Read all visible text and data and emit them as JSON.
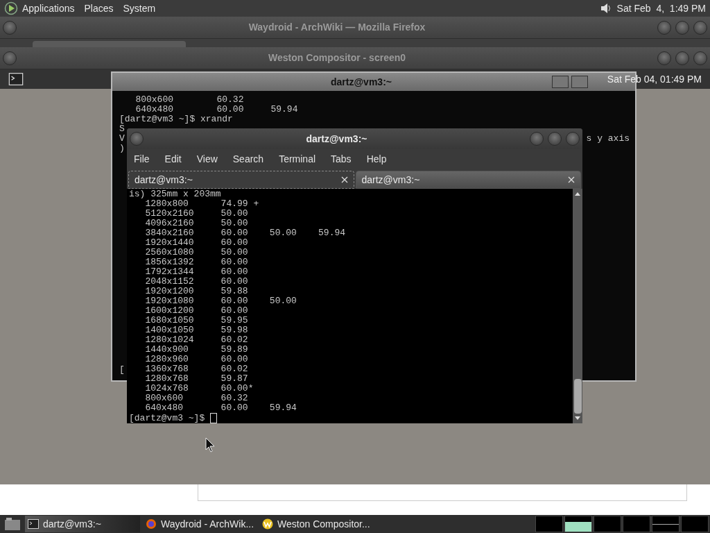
{
  "top_panel": {
    "menus": [
      "Applications",
      "Places",
      "System"
    ],
    "clock": "Sat Feb  4,  1:49 PM"
  },
  "firefox_window": {
    "title": "Waydroid - ArchWiki — Mozilla Firefox"
  },
  "weston_window": {
    "title": "Weston Compositor - screen0",
    "clock": "Sat Feb 04, 01:49 PM"
  },
  "back_terminal": {
    "title": "dartz@vm3:~",
    "lines": [
      "   800x600        60.32",
      "   640x480        60.00     59.94",
      "[dartz@vm3 ~]$ xrandr",
      "S",
      "V",
      ")"
    ],
    "right_fragment": "s y axis",
    "last_line": "["
  },
  "front_terminal": {
    "title": "dartz@vm3:~",
    "menu": [
      "File",
      "Edit",
      "View",
      "Search",
      "Terminal",
      "Tabs",
      "Help"
    ],
    "tabs": [
      {
        "label": "dartz@vm3:~",
        "selected": true
      },
      {
        "label": "dartz@vm3:~",
        "selected": false
      }
    ],
    "lines": [
      "is) 325mm x 203mm",
      "   1280x800      74.99 +",
      "   5120x2160     50.00",
      "   4096x2160     50.00",
      "   3840x2160     60.00    50.00    59.94",
      "   1920x1440     60.00",
      "   2560x1080     50.00",
      "   1856x1392     60.00",
      "   1792x1344     60.00",
      "   2048x1152     60.00",
      "   1920x1200     59.88",
      "   1920x1080     60.00    50.00",
      "   1600x1200     60.00",
      "   1680x1050     59.95",
      "   1400x1050     59.98",
      "   1280x1024     60.02",
      "   1440x900      59.89",
      "   1280x960      60.00",
      "   1360x768      60.02",
      "   1280x768      59.87",
      "   1024x768      60.00*",
      "   800x600       60.32",
      "   640x480       60.00    59.94"
    ],
    "prompt": "[dartz@vm3 ~]$ "
  },
  "taskbar": {
    "tasks": [
      {
        "kind": "terminal",
        "label": "dartz@vm3:~",
        "selected": true
      },
      {
        "kind": "browser",
        "label": "Waydroid - ArchWik...",
        "selected": false
      },
      {
        "kind": "weston",
        "label": "Weston Compositor...",
        "selected": false
      }
    ]
  }
}
